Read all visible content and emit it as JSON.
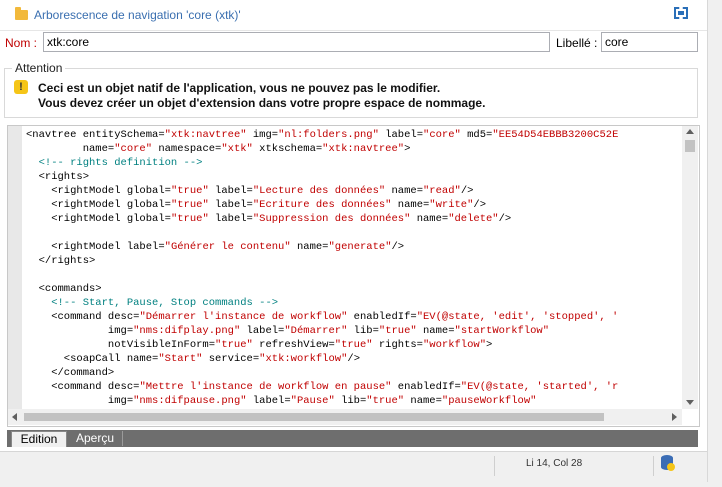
{
  "window": {
    "title": "Arborescence de navigation 'core (xtk)'"
  },
  "form": {
    "name_label": "Nom :",
    "name_value": "xtk:core",
    "libelle_label": "Libellé :",
    "libelle_value": "core"
  },
  "warning": {
    "legend": "Attention",
    "line1": "Ceci est un objet natif de l'application, vous ne pouvez pas le modifier.",
    "line2": "Vous devez créer un objet d'extension dans votre propre espace de nommage."
  },
  "code_lines": [
    [
      [
        "t",
        "<navtree "
      ],
      [
        "a",
        "entitySchema="
      ],
      [
        "s",
        "\"xtk:navtree\""
      ],
      [
        "a",
        " img="
      ],
      [
        "s",
        "\"nl:folders.png\""
      ],
      [
        "a",
        " label="
      ],
      [
        "s",
        "\"core\""
      ],
      [
        "a",
        " md5="
      ],
      [
        "s",
        "\"EE54D54EBBB3200C52E"
      ]
    ],
    [
      [
        "a",
        "         name="
      ],
      [
        "s",
        "\"core\""
      ],
      [
        "a",
        " namespace="
      ],
      [
        "s",
        "\"xtk\""
      ],
      [
        "a",
        " xtkschema="
      ],
      [
        "s",
        "\"xtk:navtree\""
      ],
      [
        "t",
        ">"
      ]
    ],
    [
      [
        "c",
        "  <!-- rights definition -->"
      ]
    ],
    [
      [
        "t",
        "  <rights>"
      ]
    ],
    [
      [
        "t",
        "    <rightModel "
      ],
      [
        "a",
        "global="
      ],
      [
        "s",
        "\"true\""
      ],
      [
        "a",
        " label="
      ],
      [
        "s",
        "\"Lecture des données\""
      ],
      [
        "a",
        " name="
      ],
      [
        "s",
        "\"read\""
      ],
      [
        "t",
        "/>"
      ]
    ],
    [
      [
        "t",
        "    <rightModel "
      ],
      [
        "a",
        "global="
      ],
      [
        "s",
        "\"true\""
      ],
      [
        "a",
        " label="
      ],
      [
        "s",
        "\"Ecriture des données\""
      ],
      [
        "a",
        " name="
      ],
      [
        "s",
        "\"write\""
      ],
      [
        "t",
        "/>"
      ]
    ],
    [
      [
        "t",
        "    <rightModel "
      ],
      [
        "a",
        "global="
      ],
      [
        "s",
        "\"true\""
      ],
      [
        "a",
        " label="
      ],
      [
        "s",
        "\"Suppression des données\""
      ],
      [
        "a",
        " name="
      ],
      [
        "s",
        "\"delete\""
      ],
      [
        "t",
        "/>"
      ]
    ],
    [
      [
        "t",
        ""
      ]
    ],
    [
      [
        "t",
        "    <rightModel "
      ],
      [
        "a",
        "label="
      ],
      [
        "s",
        "\"Générer le contenu\""
      ],
      [
        "a",
        " name="
      ],
      [
        "s",
        "\"generate\""
      ],
      [
        "t",
        "/>"
      ]
    ],
    [
      [
        "t",
        "  </rights>"
      ]
    ],
    [
      [
        "t",
        ""
      ]
    ],
    [
      [
        "t",
        "  <commands>"
      ]
    ],
    [
      [
        "c",
        "    <!-- Start, Pause, Stop commands -->"
      ]
    ],
    [
      [
        "t",
        "    <command "
      ],
      [
        "a",
        "desc="
      ],
      [
        "s",
        "\"Démarrer l'instance de workflow\""
      ],
      [
        "a",
        " enabledIf="
      ],
      [
        "s",
        "\"EV(@state, 'edit', 'stopped', '"
      ]
    ],
    [
      [
        "a",
        "             img="
      ],
      [
        "s",
        "\"nms:difplay.png\""
      ],
      [
        "a",
        " label="
      ],
      [
        "s",
        "\"Démarrer\""
      ],
      [
        "a",
        " lib="
      ],
      [
        "s",
        "\"true\""
      ],
      [
        "a",
        " name="
      ],
      [
        "s",
        "\"startWorkflow\""
      ]
    ],
    [
      [
        "a",
        "             notVisibleInForm="
      ],
      [
        "s",
        "\"true\""
      ],
      [
        "a",
        " refreshView="
      ],
      [
        "s",
        "\"true\""
      ],
      [
        "a",
        " rights="
      ],
      [
        "s",
        "\"workflow\""
      ],
      [
        "t",
        ">"
      ]
    ],
    [
      [
        "t",
        "      <soapCall "
      ],
      [
        "a",
        "name="
      ],
      [
        "s",
        "\"Start\""
      ],
      [
        "a",
        " service="
      ],
      [
        "s",
        "\"xtk:workflow\""
      ],
      [
        "t",
        "/>"
      ]
    ],
    [
      [
        "t",
        "    </command>"
      ]
    ],
    [
      [
        "t",
        "    <command "
      ],
      [
        "a",
        "desc="
      ],
      [
        "s",
        "\"Mettre l'instance de workflow en pause\""
      ],
      [
        "a",
        " enabledIf="
      ],
      [
        "s",
        "\"EV(@state, 'started', 'r"
      ]
    ],
    [
      [
        "a",
        "             img="
      ],
      [
        "s",
        "\"nms:difpause.png\""
      ],
      [
        "a",
        " label="
      ],
      [
        "s",
        "\"Pause\""
      ],
      [
        "a",
        " lib="
      ],
      [
        "s",
        "\"true\""
      ],
      [
        "a",
        " name="
      ],
      [
        "s",
        "\"pauseWorkflow\""
      ]
    ]
  ],
  "tabs": [
    {
      "label": "Edition",
      "active": true
    },
    {
      "label": "Aperçu",
      "active": false
    }
  ],
  "status": {
    "cursor": "Li 14, Col 28"
  },
  "icons": {
    "title": "folder-icon",
    "maximize": "maximize-icon",
    "warning": "warning-icon",
    "database": "database-icon"
  },
  "colors": {
    "title_text": "#3a6fb0",
    "label_red": "#c00000",
    "string": "#c00000",
    "comment": "#008080",
    "warning": "#f5c518",
    "tabbar": "#6e6e6e"
  }
}
